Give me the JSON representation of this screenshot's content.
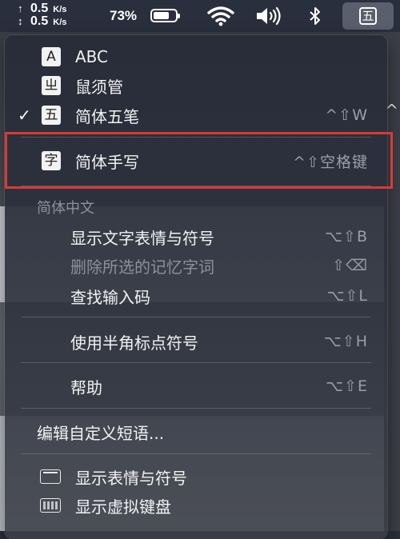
{
  "menubar": {
    "net_up": {
      "arrow": "↑",
      "value": "0.5",
      "unit": "K/s"
    },
    "net_down": {
      "arrow": "↕",
      "value": "0.5",
      "unit": "K/s"
    },
    "battery_percent": "73%",
    "battery_level": 0.73,
    "icons": [
      "wifi-icon",
      "volume-icon",
      "bluetooth-icon"
    ],
    "input_method": "五"
  },
  "menu": {
    "items": [
      {
        "badge": "A",
        "label": "ABC",
        "shortcut": "",
        "checked": false
      },
      {
        "badge": "ㄓ",
        "label": "鼠须管",
        "shortcut": "",
        "checked": false
      },
      {
        "badge": "五",
        "label": "简体五笔",
        "shortcut": "^⇧W",
        "checked": true,
        "check_mark": "✓"
      },
      {
        "badge": "字",
        "label": "简体手写",
        "shortcut": "^⇧空格键",
        "checked": false
      }
    ],
    "section_title": "简体中文",
    "section_items": [
      {
        "label": "显示文字表情与符号",
        "shortcut": "⌥⇧B",
        "disabled": false
      },
      {
        "label": "删除所选的记忆字词",
        "shortcut": "⇧⌫",
        "disabled": true
      },
      {
        "label": "查找输入码",
        "shortcut": "⌥⇧L",
        "disabled": false
      },
      {
        "label": "使用半角标点符号",
        "shortcut": "⌥⇧H",
        "disabled": false
      },
      {
        "label": "帮助",
        "shortcut": "⌥⇧E",
        "disabled": false
      }
    ],
    "edit_phrases": "编辑自定义短语...",
    "bottom_items": [
      {
        "icon": "emoji-viewer-icon",
        "label": "显示表情与符号"
      },
      {
        "icon": "keyboard-viewer-icon",
        "label": "显示虚拟键盘"
      }
    ]
  },
  "colors": {
    "highlight_border": "#d93a34",
    "menubar_bg": "#2a2f3d"
  }
}
